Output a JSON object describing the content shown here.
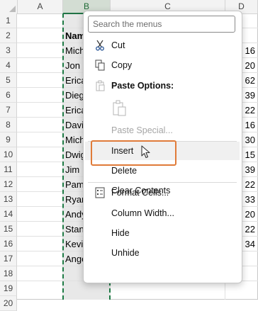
{
  "columns": [
    "A",
    "B",
    "C",
    "D"
  ],
  "rows": [
    "1",
    "2",
    "3",
    "4",
    "5",
    "6",
    "7",
    "8",
    "9",
    "10",
    "11",
    "12",
    "13",
    "14",
    "15",
    "16",
    "17",
    "18",
    "19",
    "20"
  ],
  "column_b": [
    "Nam",
    "Mich",
    "Jon",
    "Erica",
    "Dieg",
    "Erica",
    "Davi",
    "Mich",
    "Dwig",
    "Jim",
    "Pam",
    "Ryan",
    "Andy",
    "Stan",
    "Kevi",
    "Ange"
  ],
  "column_d": [
    "",
    "16",
    "20",
    "62",
    "39",
    "22",
    "16",
    "30",
    "15",
    "39",
    "22",
    "33",
    "20",
    "22",
    "34"
  ],
  "menu": {
    "search_placeholder": "Search the menus",
    "cut": "Cut",
    "copy": "Copy",
    "paste_options": "Paste Options:",
    "paste_special": "Paste Special...",
    "insert": "Insert",
    "delete": "Delete",
    "clear_contents": "Clear Contents",
    "format_cells": "Format Cells...",
    "column_width": "Column Width...",
    "hide": "Hide",
    "unhide": "Unhide"
  },
  "colors": {
    "selection_border": "#1e7b45",
    "highlight_outline": "#e07b39",
    "column_selection": "#e8e8e8"
  },
  "icons": {
    "cut": "scissors-icon",
    "copy": "copy-icon",
    "paste_options": "clipboard-icon",
    "paste": "paste-icon",
    "format_cells": "format-cells-icon",
    "cursor": "mouse-pointer-icon"
  }
}
